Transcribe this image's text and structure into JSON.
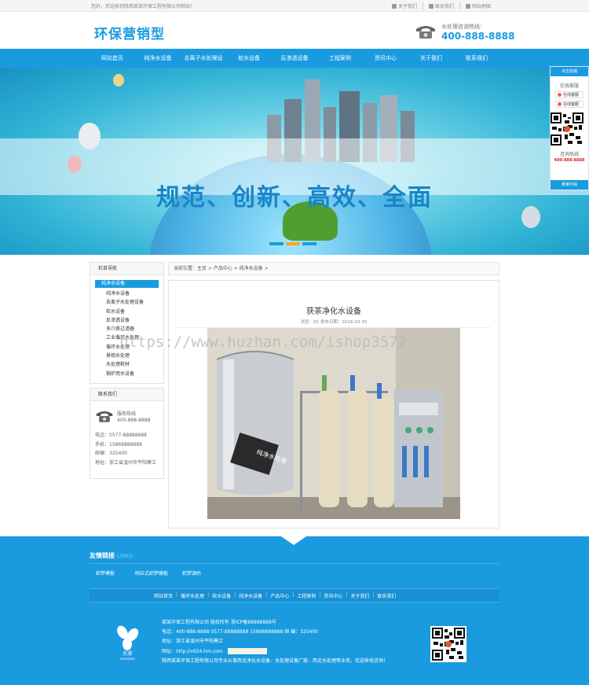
{
  "topbar": {
    "welcome": "您好，欢迎来到陕西某某环保工程有限公司网站！",
    "links": [
      "关于我们",
      "联系我们",
      "网站地图"
    ]
  },
  "header": {
    "logo": "环保营销型",
    "hotline_label": "水处理咨询热线：",
    "hotline_number": "400-888-8888"
  },
  "nav": {
    "items": [
      "网站首页",
      "纯净水设备",
      "去离子水处理设",
      "软水设备",
      "反渗透设备",
      "工程案例",
      "资讯中心",
      "关于我们",
      "联系我们"
    ]
  },
  "banner": {
    "slogan": "规范、创新、高效、全面",
    "slide_count": 3,
    "active_slide": 2
  },
  "service": {
    "header": "点击收缩",
    "online_label": "在线客服",
    "qq1": "在线客服",
    "qq2": "在线客服",
    "consult_label": "咨询热线",
    "phone": "400-888-8888",
    "footer": "某某环保"
  },
  "sidebar": {
    "category_title": "栏目导航",
    "current": "纯净水设备",
    "items": [
      "纯净水设备",
      "去离子水处理设备",
      "软水设备",
      "反渗透设备",
      "多介质过滤器",
      "工业循环水处理",
      "循环水处理",
      "景观水处理",
      "水处理耗材",
      "锅炉用水设备"
    ],
    "contact_title": "联系我们",
    "service_label": "服务热线",
    "service_phone": "400-888-8888",
    "phone": "电话：0577-88888888",
    "mobile": "手机：15868888888",
    "postcode": "邮编：325400",
    "address": "地址：浙江省温州市平阳萧江"
  },
  "breadcrumb": "当前位置：主页 > 产品中心 > 纯净水设备 >",
  "article": {
    "title": "获茶净化水设备",
    "meta": "浏览：81  发布日期：2016-03-30",
    "machine_label": "纯净水处理"
  },
  "watermark": "https://www.huzhan.com/ishop3572",
  "footer": {
    "friend_title": "友情链接",
    "friend_sub": "LINKS",
    "friend_links": [
      "织梦模板",
      "响应式织梦模板",
      "织梦源码"
    ],
    "nav": [
      "网站首页",
      "循环水处理",
      "软水设备",
      "纯净水设备",
      "产品中心",
      "工程案例",
      "资讯中心",
      "关于我们",
      "联系我们"
    ],
    "copyright": "某某环保工程有限公司 版权所有   浙ICP备88888888号",
    "contact": "电话：400-888-8888   0577-88888888   15868888888   邮   编：325400",
    "address": "地址：浙江省温州市平阳萧江",
    "website": "网址：http://v024.hm.com",
    "description": "陕西某某环保工程有限公司专业从事西北净化水设备、水处理设备厂家、西北水处理等业务，欢迎来电咨询！",
    "logo_text": "东浦",
    "logo_sub": "YONGMING"
  },
  "colors": {
    "primary": "#1a9be0",
    "accent": "#f6a623",
    "phone_red": "#d22222"
  }
}
